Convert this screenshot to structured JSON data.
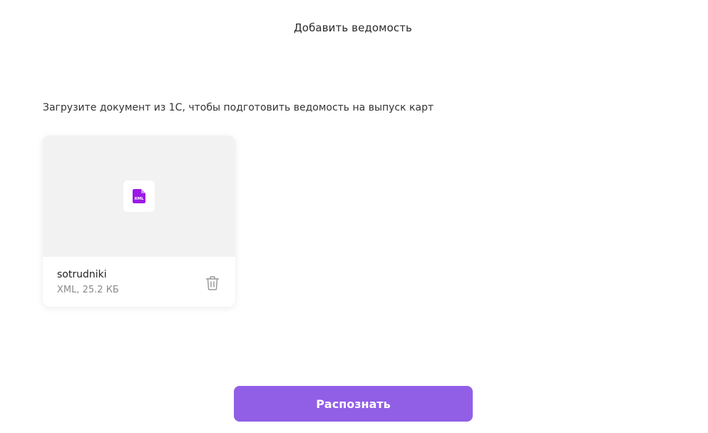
{
  "header": {
    "title": "Добавить ведомость"
  },
  "main": {
    "instruction": "Загрузите документ из 1С, чтобы подготовить ведомость на выпуск карт",
    "file": {
      "name": "sotrudniki",
      "meta": "XML, 25.2 КБ",
      "icon_label": "XML",
      "icon": "xml-file-icon"
    },
    "delete_icon": "trash-icon"
  },
  "actions": {
    "recognize_label": "Распознать"
  },
  "colors": {
    "accent": "#915ee6",
    "file_icon": "#9b1ae6",
    "preview_bg": "#f2f2f2"
  }
}
